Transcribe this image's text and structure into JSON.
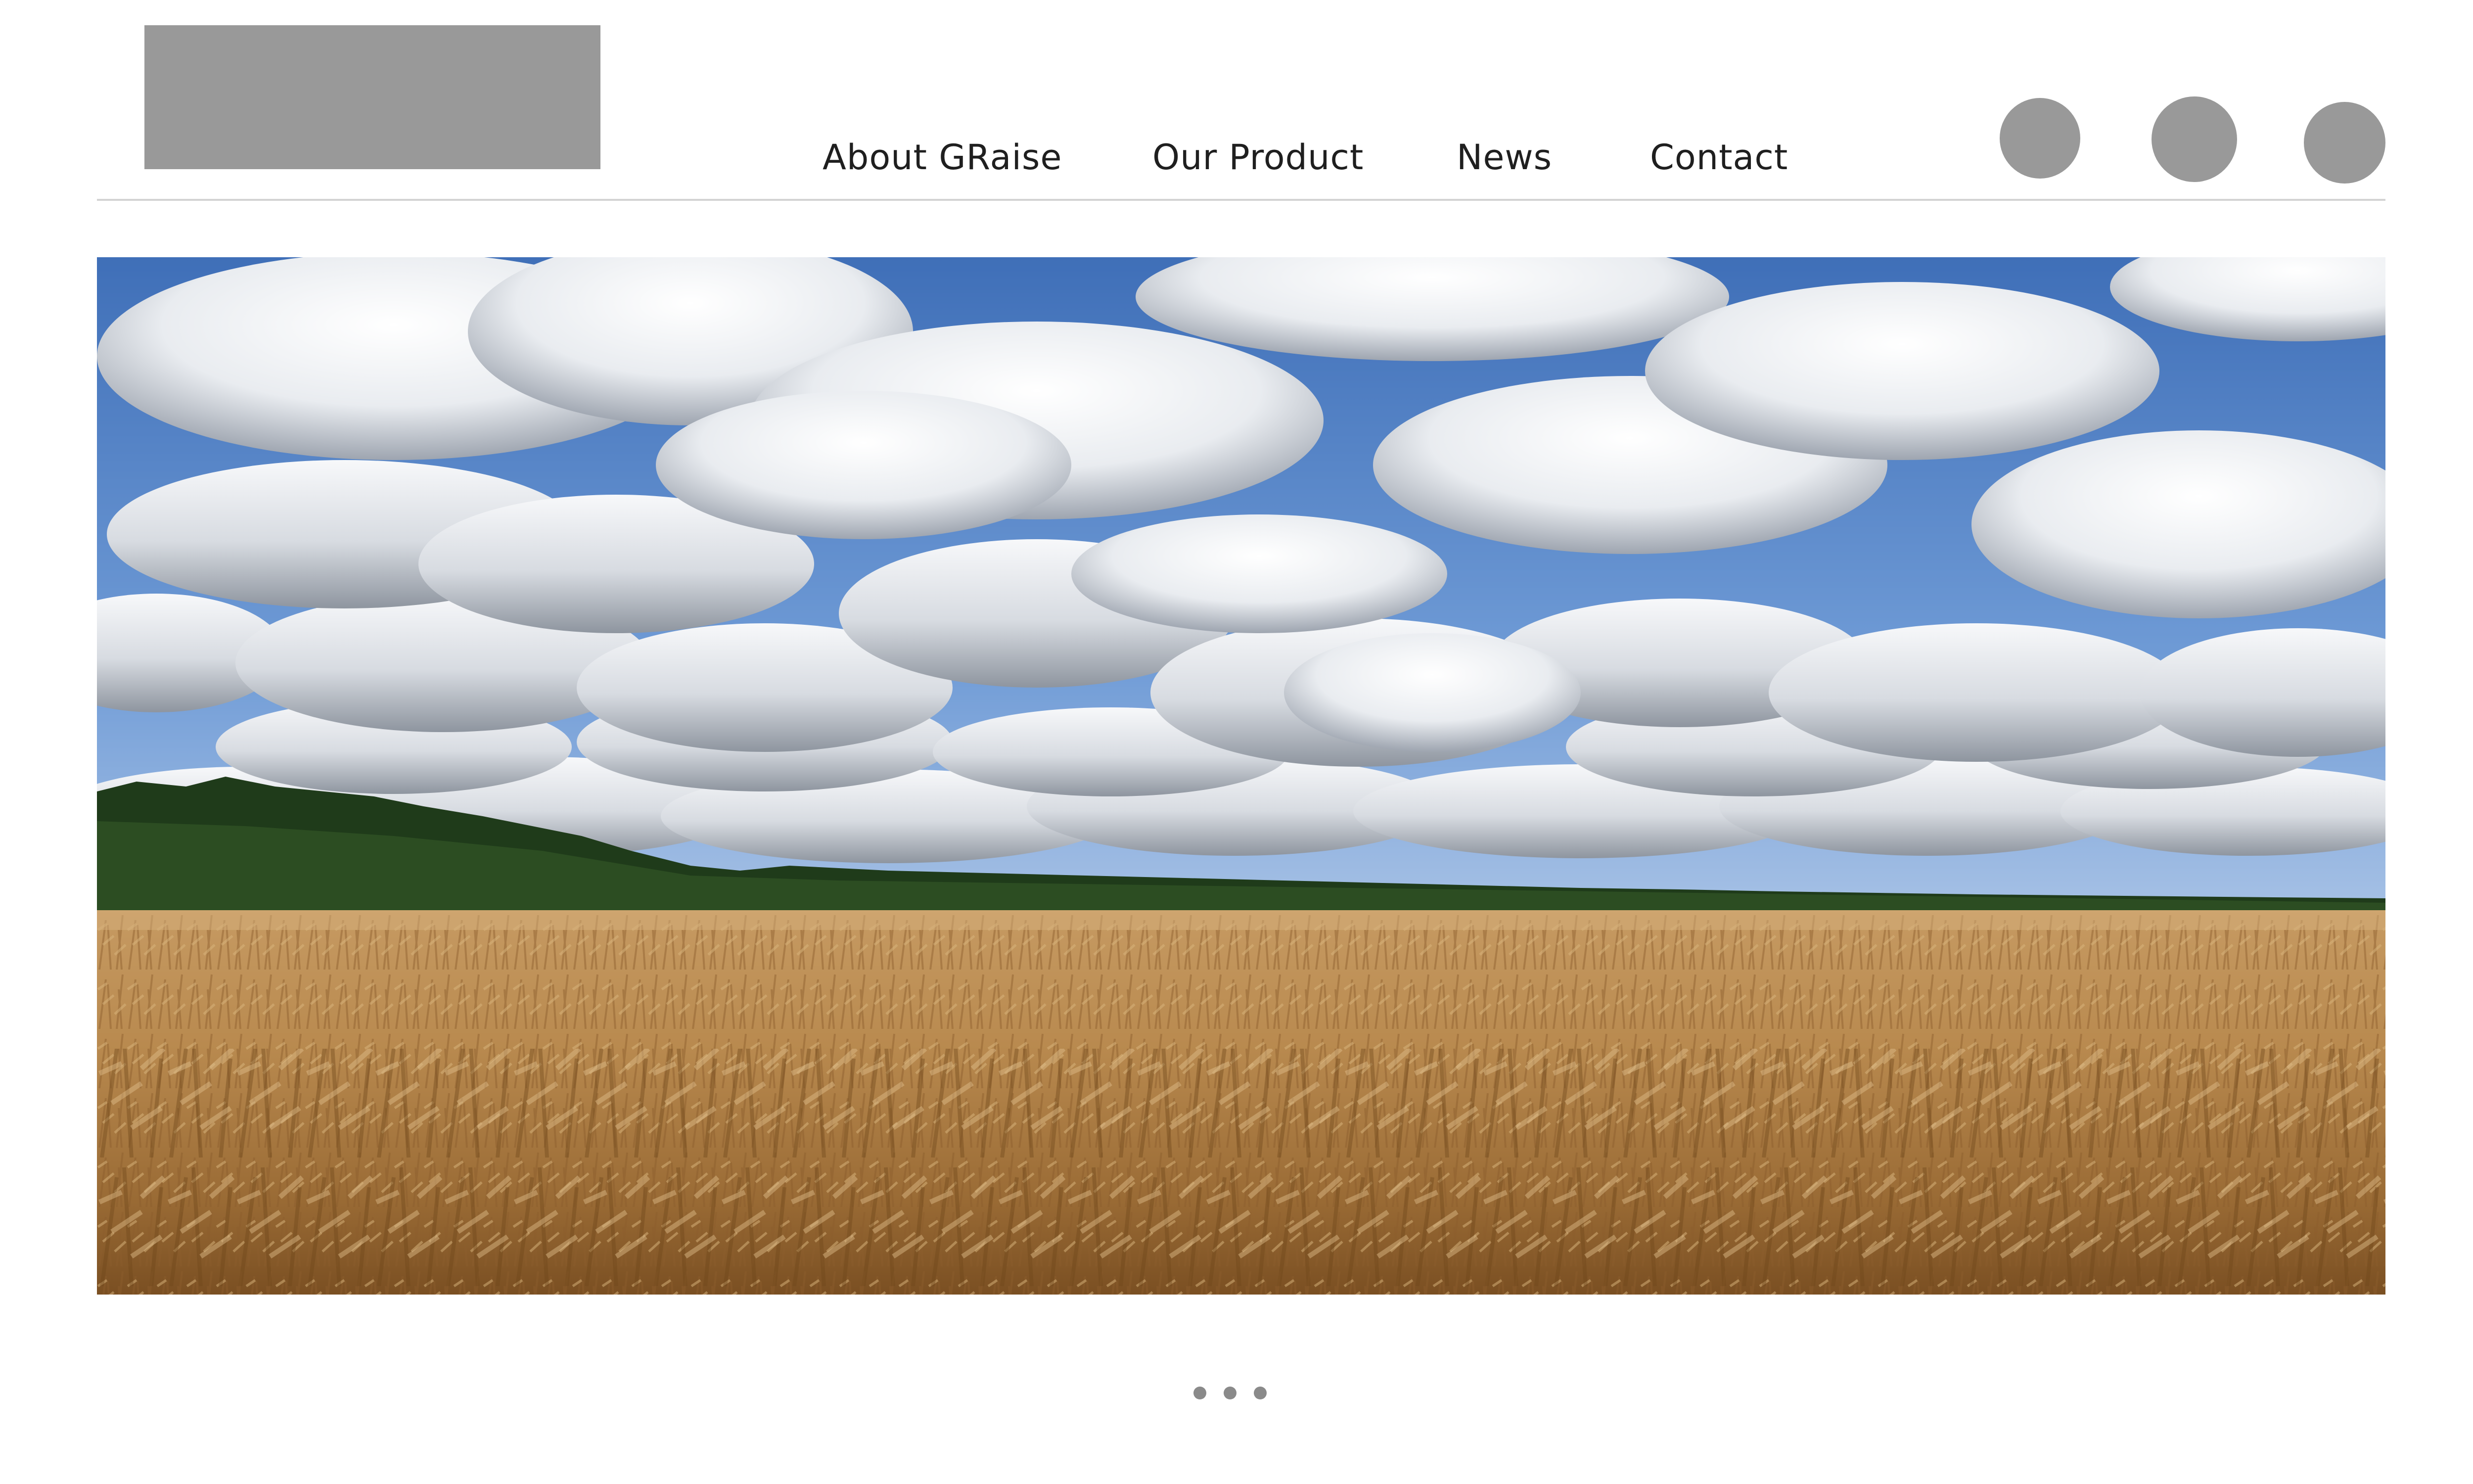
{
  "header": {
    "logo_placeholder": "logo",
    "nav": [
      {
        "label": "About GRaise"
      },
      {
        "label": "Our Product"
      },
      {
        "label": "News"
      },
      {
        "label": "Contact"
      }
    ],
    "social_icons": [
      "social-icon-1",
      "social-icon-2",
      "social-icon-3"
    ],
    "placeholder_color": "#999999"
  },
  "hero": {
    "image_subject": "field-under-cloudy-sky",
    "slide_count": 3
  },
  "colors": {
    "nav_text": "#1f1f1f",
    "divider": "#d3d3d3",
    "dot": "#8a8a8a",
    "sky": "#4f7fc4",
    "field": "#b98a4f"
  }
}
